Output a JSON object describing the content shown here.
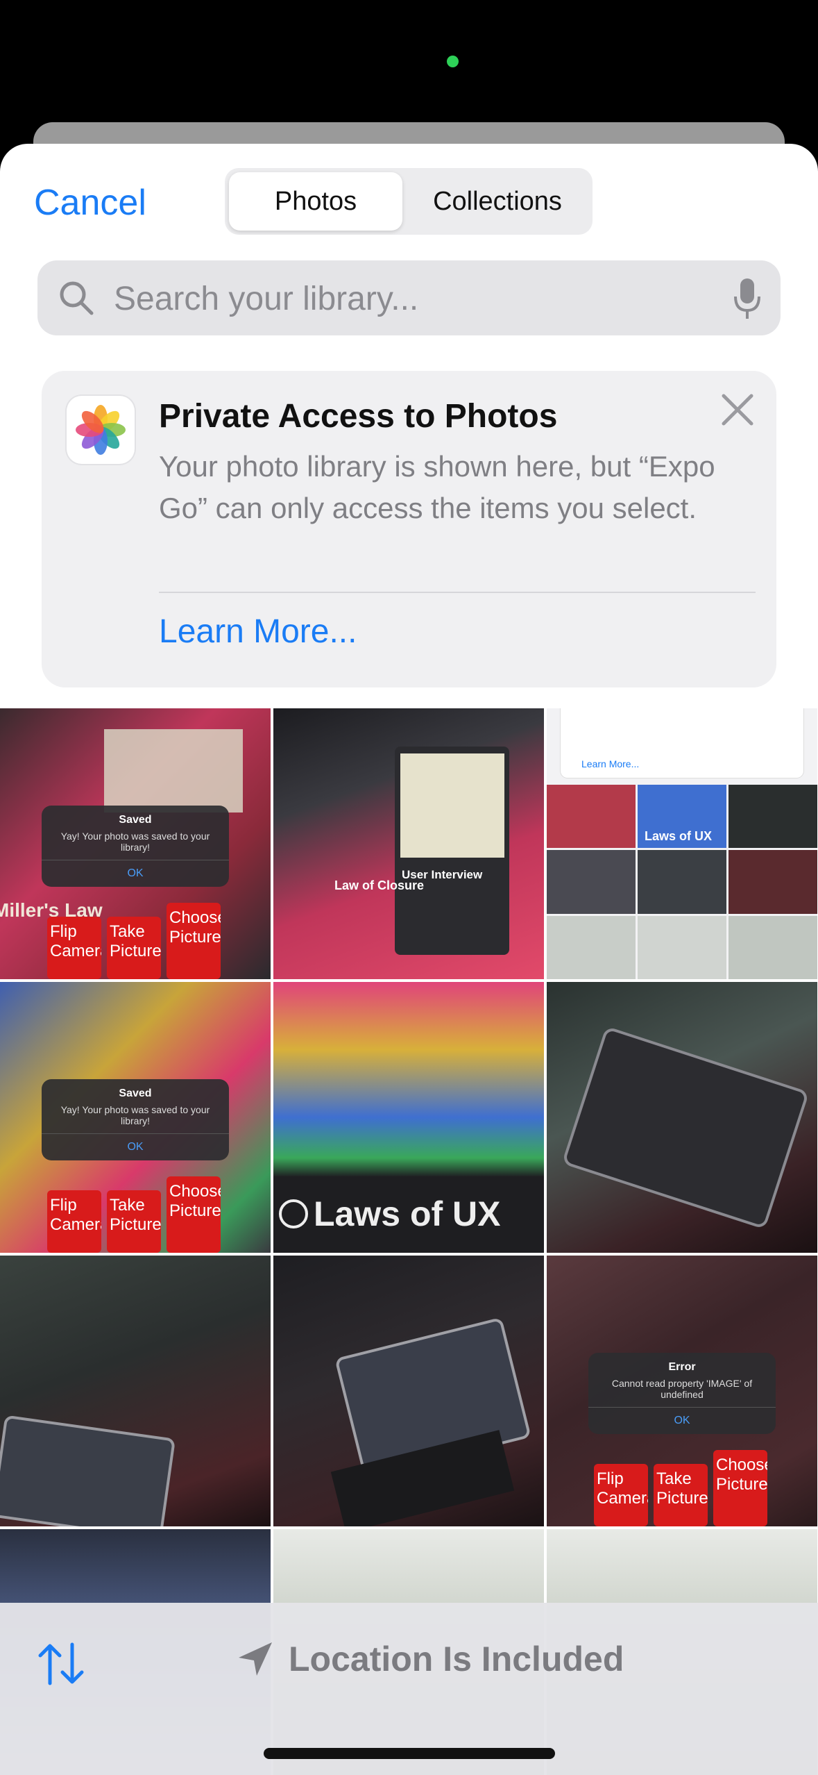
{
  "header": {
    "cancel_label": "Cancel",
    "segments": [
      {
        "label": "Photos",
        "selected": true
      },
      {
        "label": "Collections",
        "selected": false
      }
    ]
  },
  "search": {
    "placeholder": "Search your library..."
  },
  "privacy_card": {
    "title": "Private Access to Photos",
    "body": "Your photo library is shown here, but “Expo Go” can only access the items you select.",
    "link_label": "Learn More..."
  },
  "grid": {
    "photos": [
      {
        "alert_title": "Saved",
        "alert_message": "Yay! Your photo was saved to your library!",
        "alert_ok": "OK",
        "btn_labels": [
          "Flip Camera",
          "Take Picture",
          "Choose Picture"
        ],
        "caption": "Miller's Law"
      },
      {
        "title": "User Interview",
        "caption": "Law of Closure"
      },
      {
        "title": "Laws of UX",
        "link_label": "Learn More..."
      },
      {
        "alert_title": "Saved",
        "alert_message": "Yay! Your photo was saved to your library!",
        "alert_ok": "OK",
        "btn_labels": [
          "Flip Camera",
          "Take Picture",
          "Choose Picture"
        ]
      },
      {
        "title": "Laws of UX"
      },
      {},
      {},
      {},
      {
        "alert_title": "Error",
        "alert_message": "Cannot read property 'IMAGE' of undefined",
        "alert_ok": "OK",
        "btn_labels": [
          "Flip Camera",
          "Take Picture",
          "Choose Picture"
        ]
      },
      {},
      {},
      {}
    ]
  },
  "bottom_bar": {
    "location_label": "Location Is Included"
  },
  "colors": {
    "accent": "#1a7cf5",
    "status_dot": "#2ed158"
  }
}
